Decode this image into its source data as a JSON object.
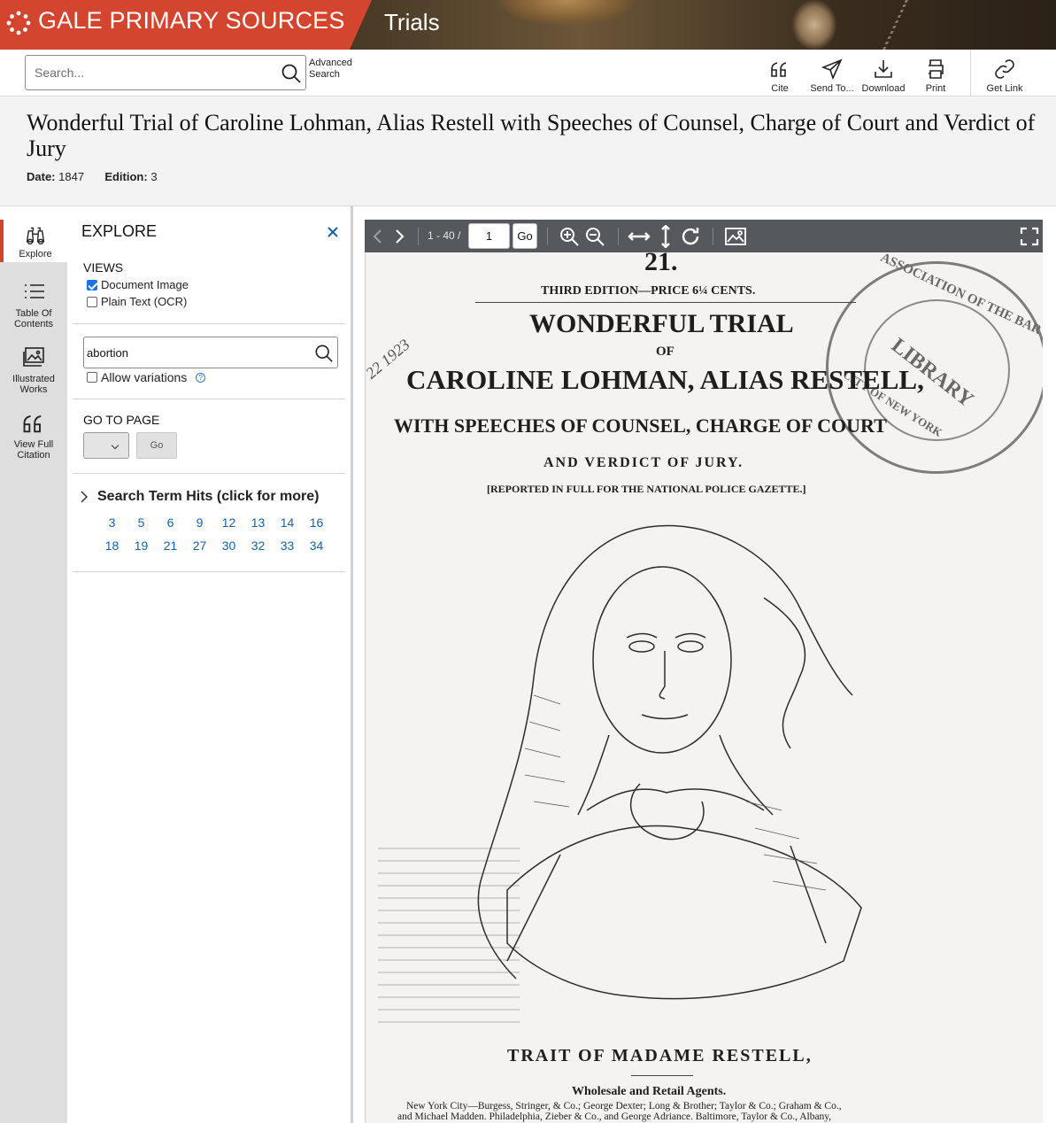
{
  "banner": {
    "brand": "GALE PRIMARY SOURCES",
    "collection": "Trials"
  },
  "search": {
    "placeholder": "Search...",
    "advanced_line1": "Advanced",
    "advanced_line2": "Search"
  },
  "tools": [
    {
      "label": "Cite",
      "icon": "quote-icon"
    },
    {
      "label": "Send To...",
      "icon": "send-icon"
    },
    {
      "label": "Download",
      "icon": "download-icon"
    },
    {
      "label": "Print",
      "icon": "print-icon"
    },
    {
      "label": "Get Link",
      "icon": "link-icon"
    }
  ],
  "document": {
    "title": "Wonderful Trial of Caroline Lohman, Alias Restell with Speeches of Counsel, Charge of Court and Verdict of Jury",
    "date_label": "Date:",
    "date": "1847",
    "edition_label": "Edition:",
    "edition": "3"
  },
  "rail": [
    {
      "label": "Explore",
      "icon": "binoculars-icon",
      "active": true
    },
    {
      "label_line1": "Table Of",
      "label_line2": "Contents",
      "icon": "list-icon"
    },
    {
      "label_line1": "Illustrated",
      "label_line2": "Works",
      "icon": "image-icon"
    },
    {
      "label_line1": "View Full",
      "label_line2": "Citation",
      "icon": "quote-icon"
    }
  ],
  "explore": {
    "title": "EXPLORE",
    "views_label": "VIEWS",
    "view_document_image": "Document Image",
    "view_document_image_checked": true,
    "view_plain_text": "Plain Text (OCR)",
    "view_plain_text_checked": false,
    "search_term": "abortion",
    "allow_variations": "Allow variations",
    "allow_variations_checked": false,
    "goto_label": "GO TO PAGE",
    "go_button": "Go",
    "hits_label": "Search Term Hits (click for more)",
    "hits": [
      "3",
      "5",
      "6",
      "9",
      "12",
      "13",
      "14",
      "16",
      "18",
      "19",
      "21",
      "27",
      "30",
      "32",
      "33",
      "34"
    ]
  },
  "viewer": {
    "page_range": "1 - 40 /",
    "current_page": "1",
    "go_button": "Go"
  },
  "page_image": {
    "number": "21.",
    "price_line": "THIRD EDITION—PRICE 6¼ CENTS.",
    "headline1": "WONDERFUL TRIAL",
    "headline2": "OF",
    "headline3": "CAROLINE LOHMAN, ALIAS RESTELL,",
    "headline4": "WITH SPEECHES OF COUNSEL, CHARGE OF COURT",
    "headline5": "AND VERDICT OF JURY.",
    "reported": "[REPORTED IN FULL FOR THE NATIONAL POLICE GAZETTE.]",
    "caption": "TRAIT OF MADAME RESTELL,",
    "agents": "Wholesale and Retail Agents.",
    "agents_line1": "New York City—Burgess, Stringer, & Co.; George Dexter; Long & Brother; Taylor & Co.; Graham & Co.,",
    "agents_line2": "and Michael Madden. Philadelphia, Zieber & Co., and George Adriance. Baltimore, Taylor & Co., Albany,",
    "stamp_outer": "ASSOCIATION OF THE BAR",
    "stamp_city": "CITY OF NEW YORK",
    "stamp_library": "LIBRARY",
    "handwritten_date": "22 1923"
  }
}
